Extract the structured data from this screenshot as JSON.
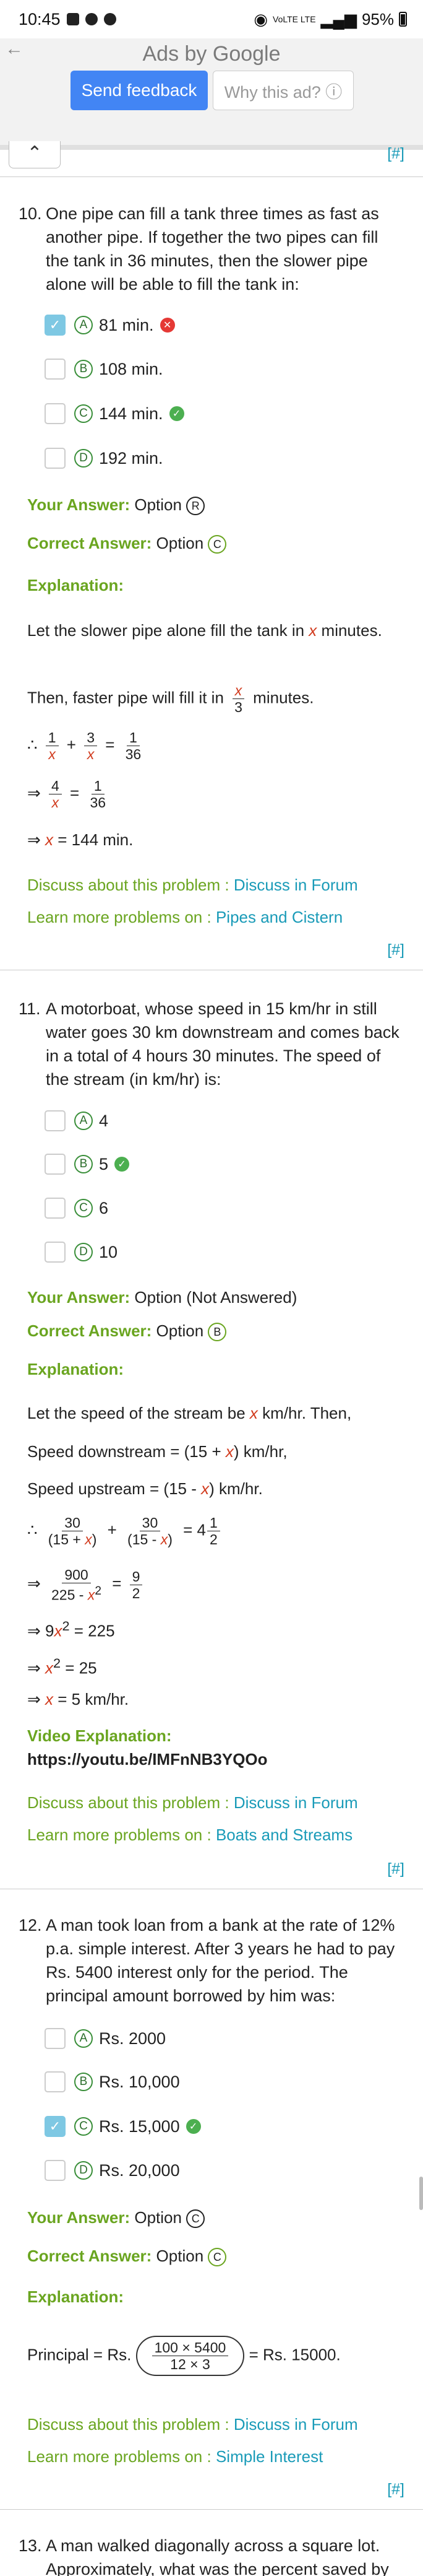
{
  "status": {
    "time": "10:45",
    "battery": "95%",
    "signal": "VoLTE LTE"
  },
  "ad": {
    "title": "Ads by Google",
    "send_feedback": "Send feedback",
    "why_ad": "Why this ad? ⓘ"
  },
  "nav": {
    "collapse_icon": "chevron-up-icon",
    "hash": "[#]"
  },
  "q10": {
    "number": "10.",
    "text": "One pipe can fill a tank three times as fast as another pipe. If together the two pipes can fill the tank in 36 minutes, then the slower pipe alone will be able to fill the tank in:",
    "options": [
      {
        "letter": "A",
        "label": "81 min.",
        "checked": true,
        "mark": "wrong"
      },
      {
        "letter": "B",
        "label": "108 min.",
        "checked": false,
        "mark": ""
      },
      {
        "letter": "C",
        "label": "144 min.",
        "checked": false,
        "mark": "right"
      },
      {
        "letter": "D",
        "label": "192 min.",
        "checked": false,
        "mark": ""
      }
    ],
    "your_answer_label": "Your Answer:",
    "your_answer_value": "Option",
    "your_answer_letter": "R",
    "correct_answer_label": "Correct Answer:",
    "correct_answer_value": "Option",
    "correct_answer_letter": "C",
    "explanation_label": "Explanation:",
    "expl1a": "Let the slower pipe alone fill the tank in",
    "expl1b": "minutes.",
    "expl2a": "Then, faster pipe will fill it in",
    "expl2b": "minutes.",
    "var_x": "x",
    "frac_den_3": "3",
    "discuss_prefix": "Discuss about this problem :",
    "discuss_link": "Discuss in Forum",
    "learn_prefix": "Learn more problems on :",
    "learn_link": "Pipes and Cistern",
    "hash": "[#]"
  },
  "q11": {
    "number": "11.",
    "text": "A motorboat, whose speed in 15 km/hr in still water goes 30 km downstream and comes back in a total of 4 hours 30 minutes. The speed of the stream (in km/hr) is:",
    "options": [
      {
        "letter": "A",
        "label": "4",
        "mark": ""
      },
      {
        "letter": "B",
        "label": "5",
        "mark": "right"
      },
      {
        "letter": "C",
        "label": "6",
        "mark": ""
      },
      {
        "letter": "D",
        "label": "10",
        "mark": ""
      }
    ],
    "your_answer_label": "Your Answer:",
    "your_answer_value": "Option (Not Answered)",
    "correct_answer_label": "Correct Answer:",
    "correct_answer_value": "Option",
    "correct_answer_letter": "B",
    "explanation_label": "Explanation:",
    "expl1a": "Let the speed of the stream be",
    "expl1b": "km/hr. Then,",
    "expl2": "Speed downstream = (15 +",
    "expl2b": ") km/hr,",
    "expl3": "Speed upstream = (15 -",
    "expl3b": ") km/hr.",
    "video_label": "Video Explanation:",
    "video_url": "https://youtu.be/IMFnNB3YQOo",
    "discuss_prefix": "Discuss about this problem :",
    "discuss_link": "Discuss in Forum",
    "learn_prefix": "Learn more problems on :",
    "learn_link": "Boats and Streams",
    "hash": "[#]"
  },
  "q12": {
    "number": "12.",
    "text": "A man took loan from a bank at the rate of 12% p.a. simple interest. After 3 years he had to pay Rs. 5400 interest only for the period. The principal amount borrowed by him was:",
    "options": [
      {
        "letter": "A",
        "label": "Rs. 2000",
        "checked": false,
        "mark": ""
      },
      {
        "letter": "B",
        "label": "Rs. 10,000",
        "checked": false,
        "mark": ""
      },
      {
        "letter": "C",
        "label": "Rs. 15,000",
        "checked": true,
        "mark": "right"
      },
      {
        "letter": "D",
        "label": "Rs. 20,000",
        "checked": false,
        "mark": ""
      }
    ],
    "your_answer_label": "Your Answer:",
    "your_answer_value": "Option",
    "your_answer_letter": "C",
    "correct_answer_label": "Correct Answer:",
    "correct_answer_value": "Option",
    "correct_answer_letter": "C",
    "explanation_label": "Explanation:",
    "principal_a": "Principal = Rs.",
    "frac_num": "100 × 5400",
    "frac_den": "12 × 3",
    "principal_b": "= Rs. 15000.",
    "discuss_prefix": "Discuss about this problem :",
    "discuss_link": "Discuss in Forum",
    "learn_prefix": "Learn more problems on :",
    "learn_link": "Simple Interest",
    "hash": "[#]"
  },
  "q13": {
    "number": "13.",
    "text": "A man walked diagonally across a square lot. Approximately, what was the percent saved by"
  }
}
